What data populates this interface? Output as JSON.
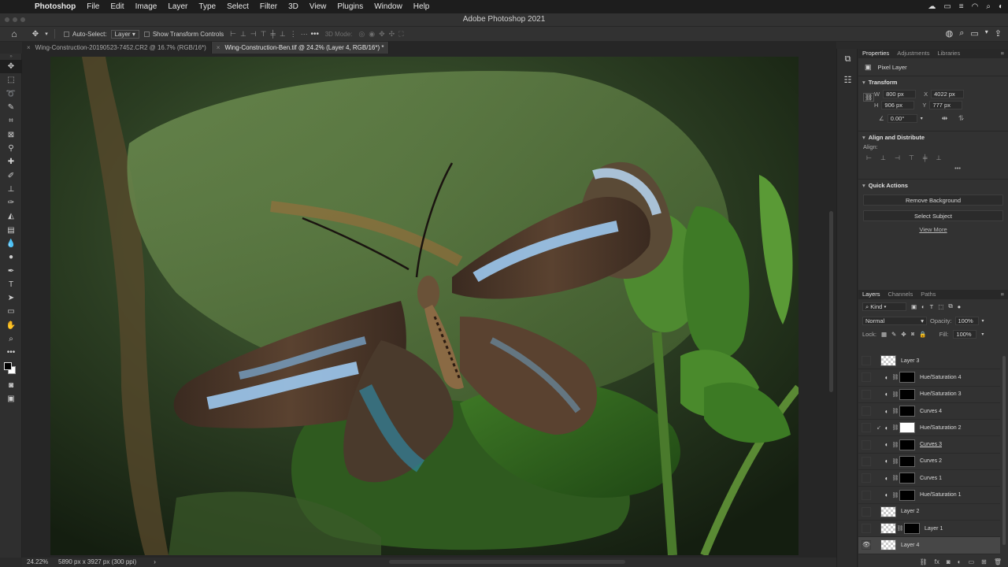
{
  "menubar": {
    "app_name": "Photoshop",
    "items": [
      "File",
      "Edit",
      "Image",
      "Layer",
      "Type",
      "Select",
      "Filter",
      "3D",
      "View",
      "Plugins",
      "Window",
      "Help"
    ]
  },
  "window_title": "Adobe Photoshop 2021",
  "options_bar": {
    "auto_select_label": "Auto-Select:",
    "auto_select_value": "Layer",
    "show_transform_label": "Show Transform Controls",
    "mode_3d_label": "3D Mode:"
  },
  "tabs": [
    {
      "label": "Wing-Construction-20190523-7452.CR2 @ 16.7% (RGB/16*)",
      "active": false
    },
    {
      "label": "Wing-Construction-Ben.tif @ 24.2% (Layer 4, RGB/16*) *",
      "active": true
    }
  ],
  "status": {
    "zoom": "24.22%",
    "doc_info": "5890 px x 3927 px (300 ppi)"
  },
  "properties": {
    "tabs": [
      "Properties",
      "Adjustments",
      "Libraries"
    ],
    "layer_kind": "Pixel Layer",
    "transform_title": "Transform",
    "w_label": "W",
    "w_value": "800 px",
    "x_label": "X",
    "x_value": "4022 px",
    "h_label": "H",
    "h_value": "906 px",
    "y_label": "Y",
    "y_value": "777 px",
    "angle_value": "0.00°",
    "align_title": "Align and Distribute",
    "align_label": "Align:",
    "quick_actions_title": "Quick Actions",
    "remove_bg": "Remove Background",
    "select_subject": "Select Subject",
    "view_more": "View More"
  },
  "layers_panel": {
    "tabs": [
      "Layers",
      "Channels",
      "Paths"
    ],
    "filter_kind": "Kind",
    "blend_mode": "Normal",
    "opacity_label": "Opacity:",
    "opacity_value": "100%",
    "lock_label": "Lock:",
    "fill_label": "Fill:",
    "fill_value": "100%",
    "layers": [
      {
        "name": "Layer 3",
        "type": "pixel",
        "visible": false
      },
      {
        "name": "Hue/Saturation 4",
        "type": "adjustment",
        "visible": false
      },
      {
        "name": "Hue/Saturation 3",
        "type": "adjustment",
        "visible": false
      },
      {
        "name": "Curves 4",
        "type": "adjustment",
        "visible": false
      },
      {
        "name": "Hue/Saturation 2",
        "type": "adjustment",
        "visible": false,
        "clipped": true
      },
      {
        "name": "Curves 3",
        "type": "adjustment",
        "visible": false
      },
      {
        "name": "Curves 2",
        "type": "adjustment",
        "visible": false
      },
      {
        "name": "Curves 1",
        "type": "adjustment",
        "visible": false
      },
      {
        "name": "Hue/Saturation 1",
        "type": "adjustment",
        "visible": false
      },
      {
        "name": "Layer 2",
        "type": "pixel",
        "visible": false
      },
      {
        "name": "Layer 1",
        "type": "pixel-masked",
        "visible": false
      },
      {
        "name": "Layer 4",
        "type": "pixel",
        "visible": true,
        "selected": true
      }
    ]
  }
}
